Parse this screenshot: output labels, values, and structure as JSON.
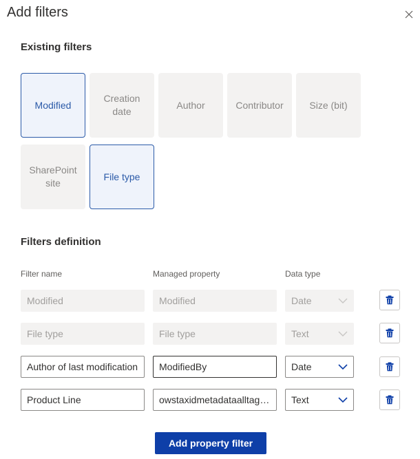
{
  "dialog": {
    "title": "Add filters"
  },
  "existing": {
    "heading": "Existing filters",
    "tiles": [
      {
        "label": "Modified",
        "selected": true
      },
      {
        "label": "Creation date",
        "selected": false
      },
      {
        "label": "Author",
        "selected": false
      },
      {
        "label": "Contributor",
        "selected": false
      },
      {
        "label": "Size (bit)",
        "selected": false
      },
      {
        "label": "SharePoint site",
        "selected": false
      },
      {
        "label": "File type",
        "selected": true
      }
    ]
  },
  "definition": {
    "heading": "Filters definition",
    "columns": {
      "name": "Filter name",
      "property": "Managed property",
      "type": "Data type"
    },
    "rows": [
      {
        "name": "Modified",
        "property": "Modified",
        "type": "Date",
        "enabled": false
      },
      {
        "name": "File type",
        "property": "File type",
        "type": "Text",
        "enabled": false
      },
      {
        "name": "Author of last modification",
        "property": "ModifiedBy",
        "type": "Date",
        "enabled": true
      },
      {
        "name": "Product Line",
        "property": "owstaxidmetadataalltagsinfo",
        "type": "Text",
        "enabled": true
      }
    ]
  },
  "actions": {
    "add_label": "Add property filter"
  },
  "colors": {
    "accent": "#2b5aa8",
    "primary": "#0e3fa8",
    "disabled_bg": "#f3f2f1"
  },
  "icons": {
    "close": "close-icon",
    "delete": "trash-icon",
    "dropdown": "chevron-down-icon"
  }
}
